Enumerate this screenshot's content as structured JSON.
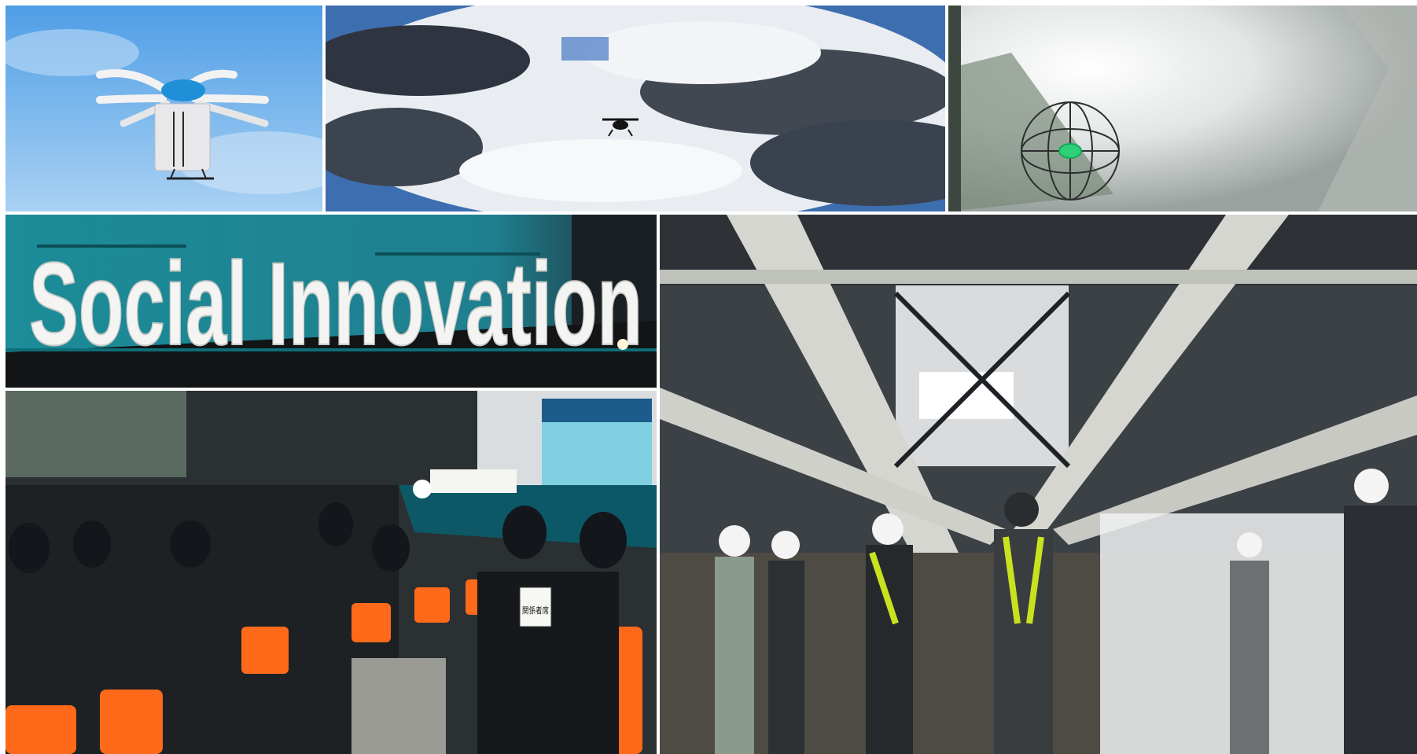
{
  "collage": {
    "background": "#ffffff",
    "tiles": [
      {
        "id": "cargo-drone",
        "icon": "drone-icon",
        "colors": {
          "sky_top": "#4f9ee6",
          "sky_bottom": "#a9d1f3",
          "body": "#e8e8ea",
          "dome": "#1f8fd8"
        }
      },
      {
        "id": "drone-in-clouds",
        "icon": "drone-icon",
        "colors": {
          "sky": "#3d6fb0",
          "cloud_dark": "#2f3540",
          "cloud_light": "#f2f4f7"
        }
      },
      {
        "id": "cage-drone",
        "icon": "cage-drone-icon",
        "colors": {
          "wall": "#d8dcdc",
          "light": "#ffffff",
          "beam": "#5b6b5a",
          "led": "#2fcf7a"
        }
      },
      {
        "id": "stage-sign",
        "icon": "sign-letters-icon",
        "colors": {
          "backdrop": "#1c8c98",
          "letters": "#f4f4f2",
          "stage": "#121416"
        }
      },
      {
        "id": "bridge-inspection",
        "icon": "bridge-beam-icon",
        "colors": {
          "steel": "#3c4146",
          "beam": "#d5d6d0",
          "light": "#ffffff",
          "vest": "#c9e21f",
          "helmet": "#f4f4f4"
        }
      },
      {
        "id": "conference-audience",
        "icon": "audience-icon",
        "colors": {
          "hall": "#2b3033",
          "chairs": "#ff6a1a",
          "screen": "#7fd0e0",
          "stage_light": "#ffffff"
        }
      }
    ],
    "texts": {
      "sign": "Social Innovation",
      "seat_sign": "関係者席"
    }
  }
}
